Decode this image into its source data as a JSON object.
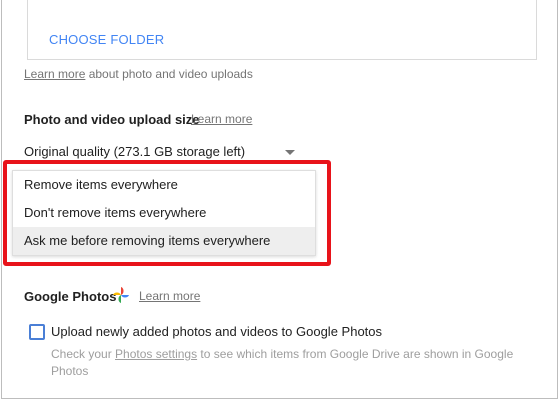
{
  "folder": {
    "choose_label": "CHOOSE FOLDER"
  },
  "uploads_info": {
    "link": "Learn more",
    "text": " about photo and video uploads"
  },
  "upload_size": {
    "title": "Photo and video upload size",
    "learn_more": "Learn more",
    "selected": "Original quality (273.1 GB storage left)"
  },
  "menu": {
    "items": [
      {
        "label": "Remove items everywhere"
      },
      {
        "label": "Don't remove items everywhere"
      },
      {
        "label": "Ask me before removing items everywhere"
      }
    ],
    "hovered_index": 2
  },
  "google_photos": {
    "title": "Google Photos",
    "icon": "google-photos-pinwheel-icon",
    "learn_more": "Learn more",
    "checkbox_label": "Upload newly added photos and videos to Google Photos",
    "checkbox_checked": false,
    "help_prefix": "Check your ",
    "help_link": "Photos settings",
    "help_suffix": " to see which items from Google Drive are shown in Google Photos"
  },
  "colors": {
    "accent": "#4285f4",
    "annotation": "#e8131a"
  }
}
